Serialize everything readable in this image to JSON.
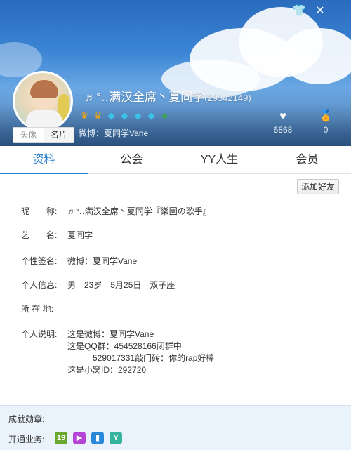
{
  "header": {
    "nickname": "♬°‥满汉全席丶夏同学",
    "yy_id": "(29342149)",
    "weibo_line": "微博：夏同学Vane",
    "avatar_tab": "头像",
    "card_tab": "名片",
    "stats": [
      {
        "icon": "heart-icon",
        "glyph": "♥",
        "value": "6868"
      },
      {
        "icon": "award-icon",
        "glyph": "🏅",
        "value": "0"
      }
    ],
    "badges": [
      {
        "icon": "crown-gold-icon",
        "glyph": "♛",
        "color": "#e8a21b"
      },
      {
        "icon": "crown-gold-icon",
        "glyph": "♛",
        "color": "#e8a21b"
      },
      {
        "icon": "diamond-icon",
        "glyph": "◆",
        "color": "#3cc2e8"
      },
      {
        "icon": "diamond-icon",
        "glyph": "◆",
        "color": "#3cc2e8"
      },
      {
        "icon": "diamond-icon",
        "glyph": "◆",
        "color": "#3cc2e8"
      },
      {
        "icon": "diamond-icon",
        "glyph": "◆",
        "color": "#3cc2e8"
      },
      {
        "icon": "leaf-icon",
        "glyph": "♣",
        "color": "#3aa54a"
      }
    ],
    "window_buttons": {
      "skin": "👕",
      "close": "✕"
    }
  },
  "tabs": [
    "资料",
    "公会",
    "YY人生",
    "会员"
  ],
  "add_friend": "添加好友",
  "profile": {
    "nickname_label": "昵　　称:",
    "nickname_value": "♬°‥满汉全席丶夏同学『樂園の歌手』",
    "stage_label": "艺　　名:",
    "stage_value": "夏同学",
    "signature_label": "个性签名:",
    "signature_value": "微博：夏同学Vane",
    "personal_label": "个人信息:",
    "personal_value": "男　23岁　5月25日　双子座",
    "location_label": "所 在 地:",
    "location_value": "",
    "desc_label": "个人说明:",
    "desc_lines": [
      "这是微博：夏同学Vane",
      "这是QQ群：454528166闭群中",
      "　　　529017331敲门砖：你的rap好棒",
      "这是小窝ID：292720"
    ]
  },
  "footer": {
    "achievements_label": "成就勋章:",
    "services_label": "开通业务:",
    "services": [
      {
        "icon": "vip-level-icon",
        "glyph": "19",
        "color": "#6aa731"
      },
      {
        "icon": "play-icon",
        "glyph": "▶",
        "color": "#b443d6"
      },
      {
        "icon": "card-icon",
        "glyph": "▮",
        "color": "#2a88d8"
      },
      {
        "icon": "yy-icon",
        "glyph": "Y",
        "color": "#35b59d"
      }
    ]
  }
}
